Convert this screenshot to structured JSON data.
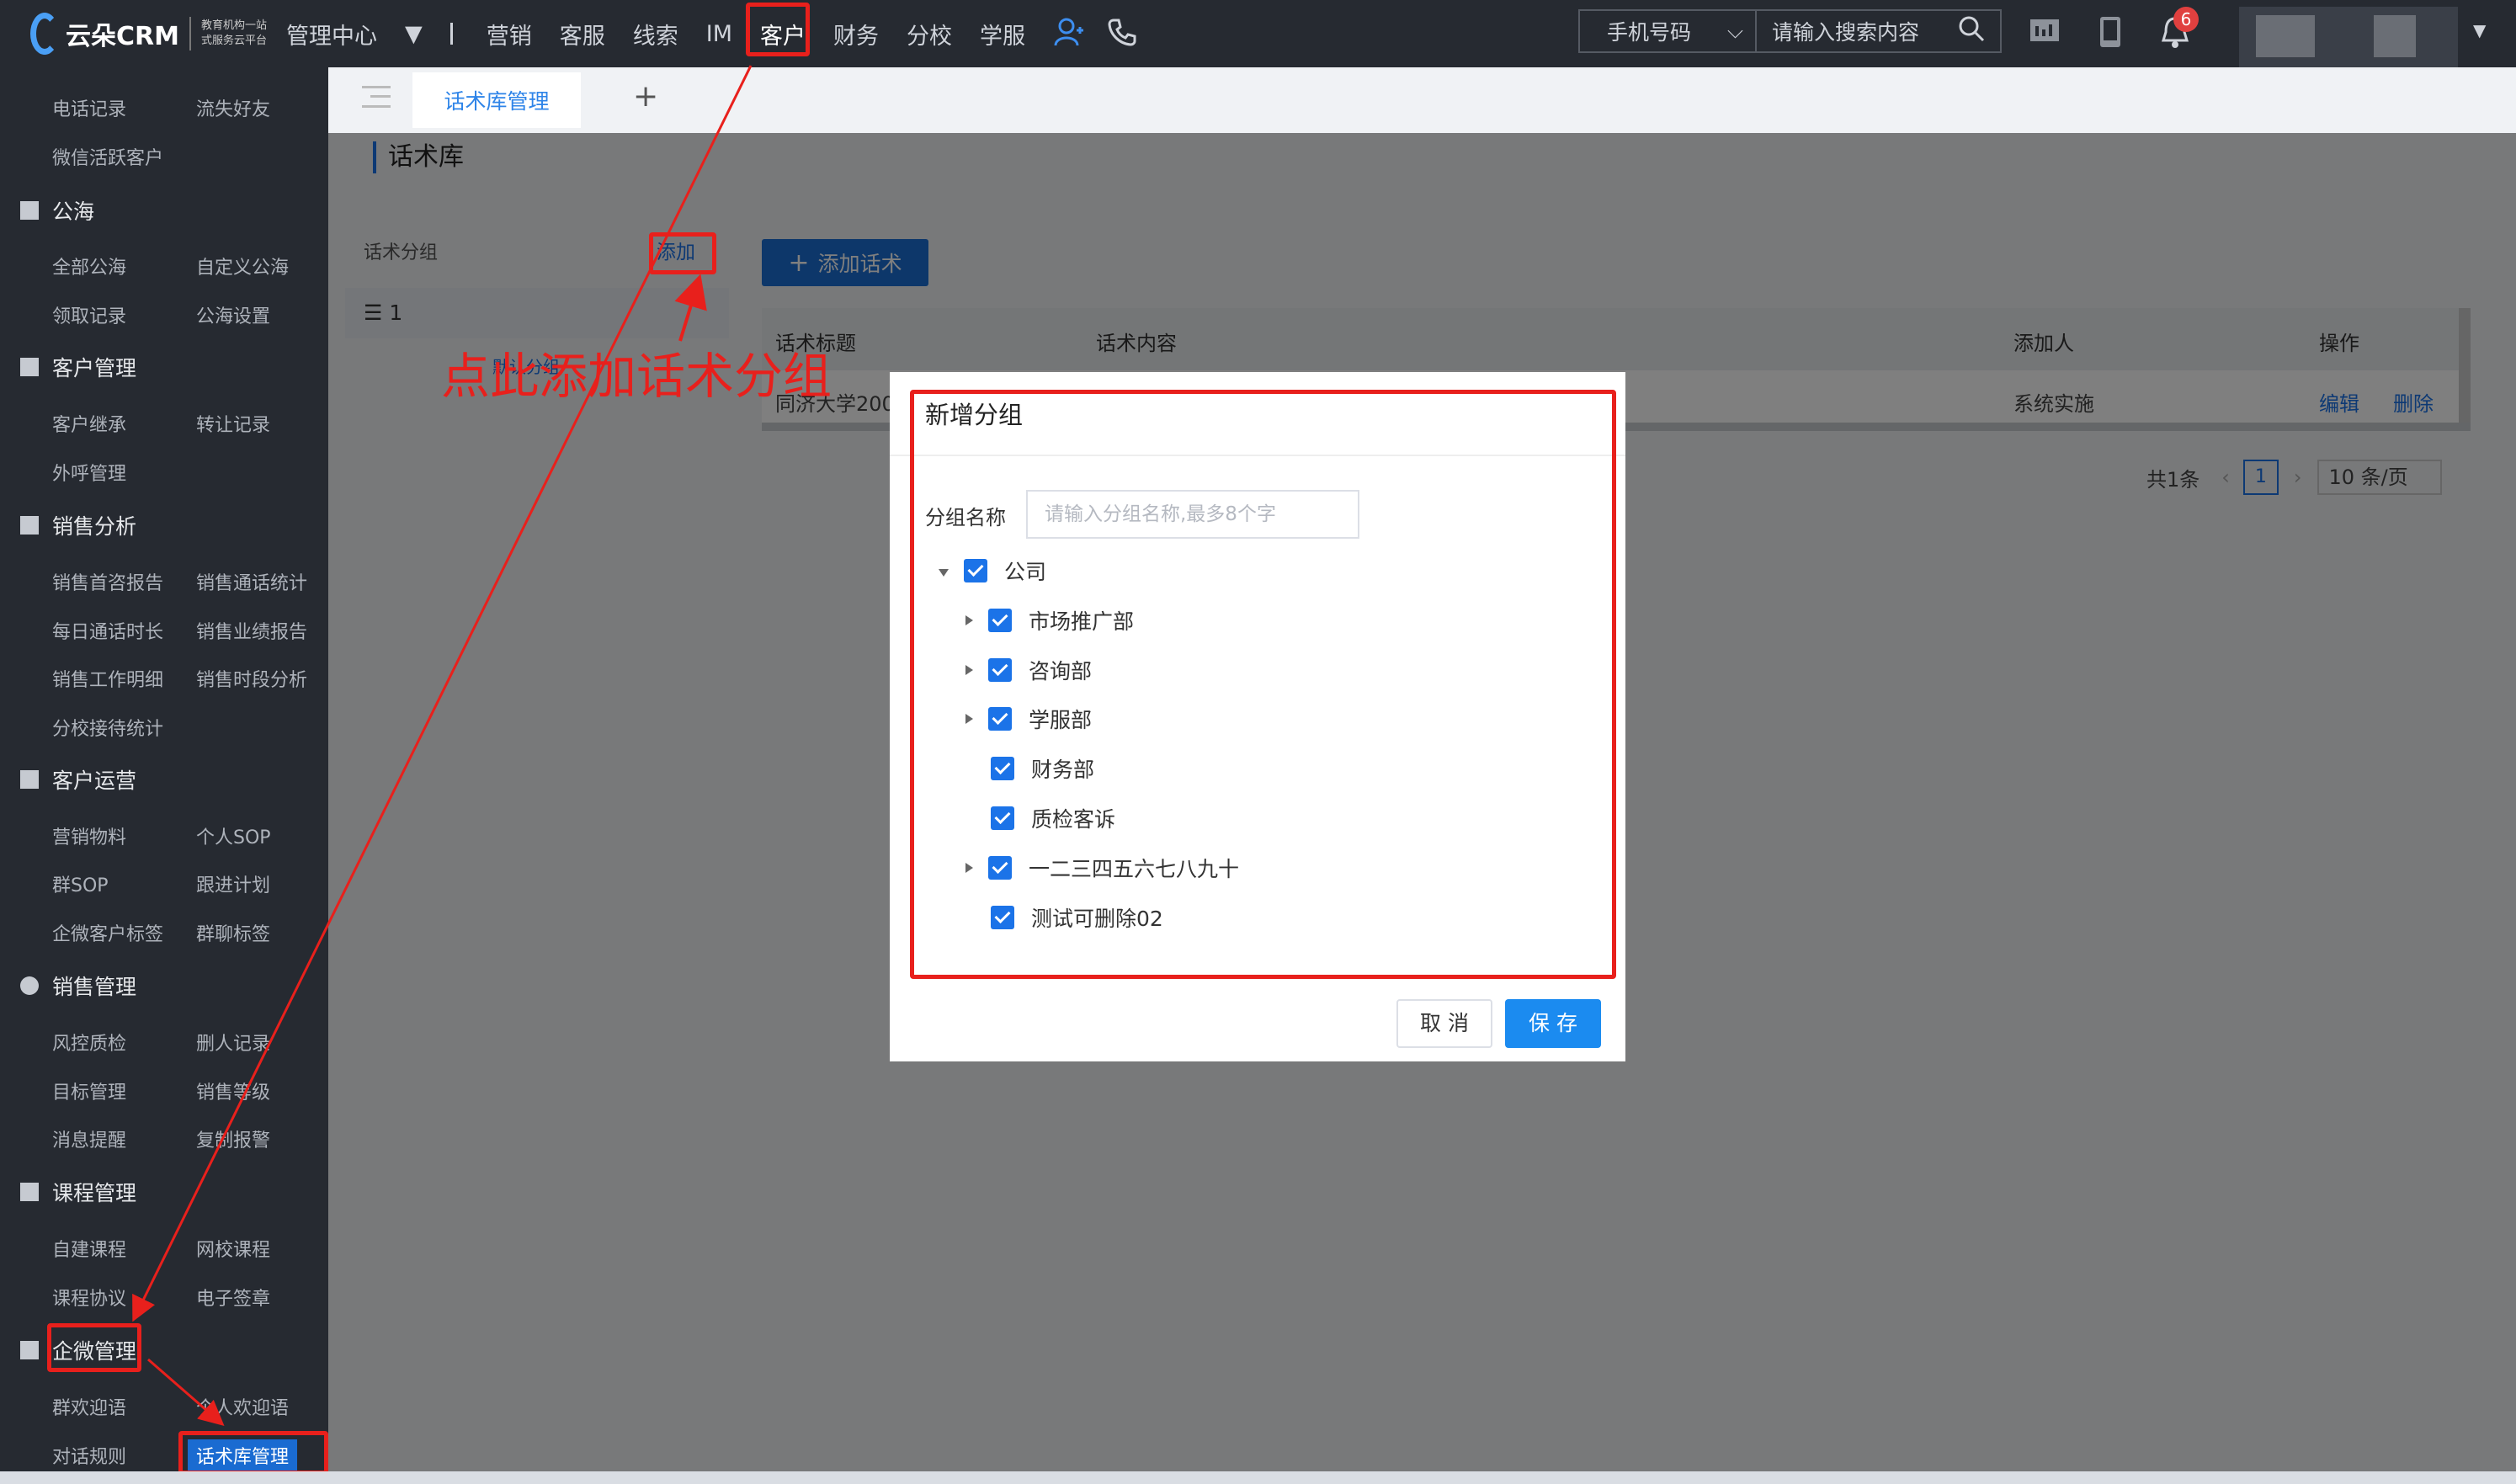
{
  "header": {
    "logo_text": "云朵CRM",
    "logo_slogan_1": "教育机构一站",
    "logo_slogan_2": "式服务云平台",
    "nav": [
      "管理中心",
      "营销",
      "客服",
      "线索",
      "IM",
      "客户",
      "财务",
      "分校",
      "学服"
    ],
    "active_nav": "客户",
    "search_type": "手机号码",
    "search_placeholder": "请输入搜索内容",
    "notification_count": "6"
  },
  "sidebar": {
    "top_items": [
      "电话记录",
      "流失好友",
      "微信活跃客户"
    ],
    "sections": [
      {
        "title": "公海",
        "items": [
          "全部公海",
          "自定义公海",
          "领取记录",
          "公海设置"
        ]
      },
      {
        "title": "客户管理",
        "items": [
          "客户继承",
          "转让记录",
          "外呼管理"
        ]
      },
      {
        "title": "销售分析",
        "items": [
          "销售首咨报告",
          "销售通话统计",
          "每日通话时长",
          "销售业绩报告",
          "销售工作明细",
          "销售时段分析",
          "分校接待统计"
        ]
      },
      {
        "title": "客户运营",
        "items": [
          "营销物料",
          "个人SOP",
          "群SOP",
          "跟进计划",
          "企微客户标签",
          "群聊标签"
        ]
      },
      {
        "title": "销售管理",
        "items": [
          "风控质检",
          "删人记录",
          "目标管理",
          "销售等级",
          "消息提醒",
          "复制报警"
        ]
      },
      {
        "title": "课程管理",
        "items": [
          "自建课程",
          "网校课程",
          "课程协议",
          "电子签章"
        ]
      },
      {
        "title": "企微管理",
        "items": [
          "群欢迎语",
          "个人欢迎语",
          "对话规则",
          "话术库管理"
        ]
      }
    ]
  },
  "tabs": {
    "active": "话术库管理"
  },
  "page": {
    "title": "话术库",
    "group_label": "话术分组",
    "add_group_link": "添加",
    "group_item": "1",
    "group_item_sub": "默认分组",
    "add_script_button": "添加话术",
    "table": {
      "headers": [
        "话术标题",
        "话术内容",
        "添加人",
        "操作"
      ],
      "rows": [
        {
          "title": "同济大学200",
          "content": "",
          "creator": "系统实施",
          "edit": "编辑",
          "delete": "删除"
        }
      ]
    },
    "pagination": {
      "total": "共1条",
      "current": "1",
      "page_size": "10 条/页"
    }
  },
  "dialog": {
    "title": "新增分组",
    "name_label": "分组名称",
    "name_placeholder": "请输入分组名称,最多8个字",
    "tree": [
      {
        "label": "公司",
        "level": 0,
        "expand": "down",
        "checked": true
      },
      {
        "label": "市场推广部",
        "level": 1,
        "expand": "right",
        "checked": true
      },
      {
        "label": "咨询部",
        "level": 1,
        "expand": "right",
        "checked": true
      },
      {
        "label": "学服部",
        "level": 1,
        "expand": "right",
        "checked": true
      },
      {
        "label": "财务部",
        "level": 1,
        "expand": "none",
        "checked": true
      },
      {
        "label": "质检客诉",
        "level": 1,
        "expand": "none",
        "checked": true
      },
      {
        "label": "一二三四五六七八九十",
        "level": 1,
        "expand": "right",
        "checked": true
      },
      {
        "label": "测试可删除02",
        "level": 1,
        "expand": "none",
        "checked": true
      }
    ],
    "cancel": "取 消",
    "save": "保 存"
  },
  "annotation": {
    "text": "点此添加话术分组",
    "color": "#e8201c"
  },
  "colors": {
    "accent": "#1b73e8",
    "sidebar_bg": "#262a31",
    "annotation": "#e8201c"
  }
}
